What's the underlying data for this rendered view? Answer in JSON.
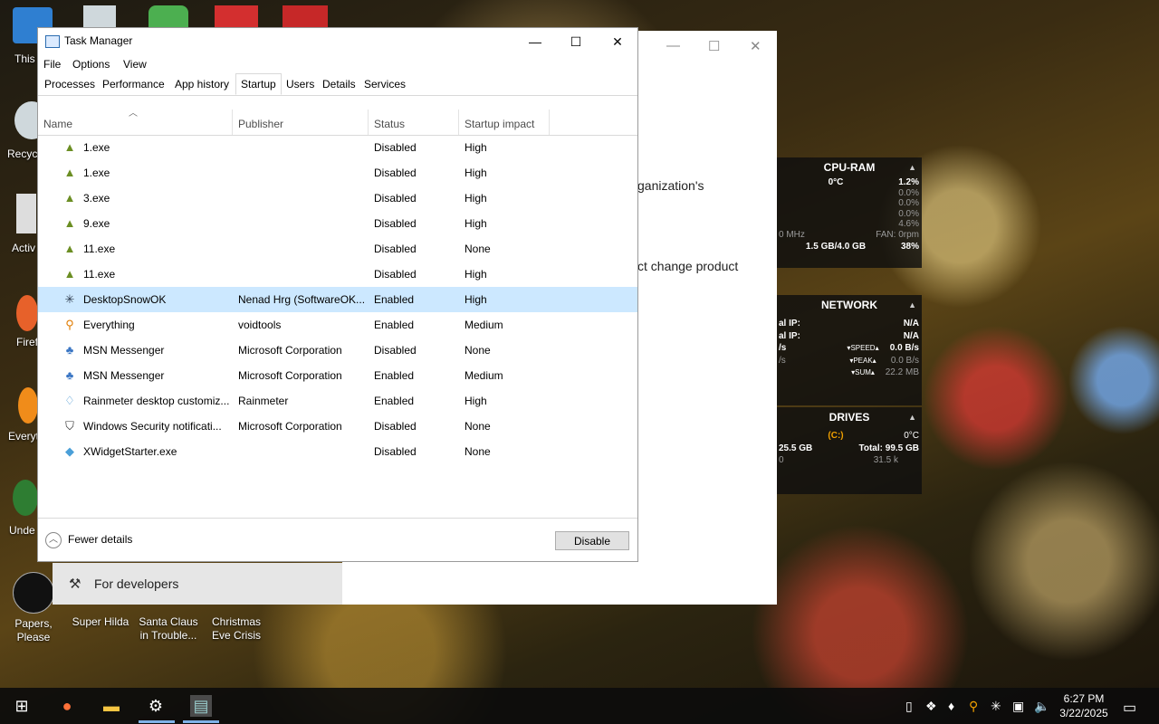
{
  "desktop": {
    "icons": [
      {
        "label": "Papers,\nPlease"
      },
      {
        "label": "Super Hilda"
      },
      {
        "label": "Santa Claus\nin Trouble..."
      },
      {
        "label": "Christmas\nEve Crisis"
      }
    ],
    "left_labels": [
      "This",
      "Recycl",
      "Activ",
      "Firef",
      "Everyt",
      "Unde"
    ]
  },
  "bg_window": {
    "text1": "ganization's",
    "text2": "ct change product",
    "side_label": "For developers"
  },
  "task_manager": {
    "title": "Task Manager",
    "menu": [
      "File",
      "Options",
      "View"
    ],
    "tabs": [
      "Processes",
      "Performance",
      "App history",
      "Startup",
      "Users",
      "Details",
      "Services"
    ],
    "active_tab": "Startup",
    "columns": [
      "Name",
      "Publisher",
      "Status",
      "Startup impact"
    ],
    "rows": [
      {
        "icon": "tree-icon",
        "name": "1.exe",
        "publisher": "",
        "status": "Disabled",
        "impact": "High"
      },
      {
        "icon": "tree-icon",
        "name": "1.exe",
        "publisher": "",
        "status": "Disabled",
        "impact": "High"
      },
      {
        "icon": "tree-icon",
        "name": "3.exe",
        "publisher": "",
        "status": "Disabled",
        "impact": "High"
      },
      {
        "icon": "tree-icon",
        "name": "9.exe",
        "publisher": "",
        "status": "Disabled",
        "impact": "High"
      },
      {
        "icon": "tree-icon",
        "name": "11.exe",
        "publisher": "",
        "status": "Disabled",
        "impact": "None"
      },
      {
        "icon": "tree-icon",
        "name": "11.exe",
        "publisher": "",
        "status": "Disabled",
        "impact": "High"
      },
      {
        "icon": "snowflake-icon",
        "name": "DesktopSnowOK",
        "publisher": "Nenad Hrg (SoftwareOK...",
        "status": "Enabled",
        "impact": "High",
        "selected": true
      },
      {
        "icon": "magnifier-icon",
        "name": "Everything",
        "publisher": "voidtools",
        "status": "Enabled",
        "impact": "Medium"
      },
      {
        "icon": "messenger-icon",
        "name": "MSN Messenger",
        "publisher": "Microsoft Corporation",
        "status": "Disabled",
        "impact": "None"
      },
      {
        "icon": "messenger-icon",
        "name": "MSN Messenger",
        "publisher": "Microsoft Corporation",
        "status": "Enabled",
        "impact": "Medium"
      },
      {
        "icon": "droplet-icon",
        "name": "Rainmeter desktop customiz...",
        "publisher": "Rainmeter",
        "status": "Enabled",
        "impact": "High"
      },
      {
        "icon": "shield-icon",
        "name": "Windows Security notificati...",
        "publisher": "Microsoft Corporation",
        "status": "Disabled",
        "impact": "None"
      },
      {
        "icon": "widget-icon",
        "name": "XWidgetStarter.exe",
        "publisher": "",
        "status": "Disabled",
        "impact": "None"
      }
    ],
    "fewer_details": "Fewer details",
    "disable_button": "Disable"
  },
  "cpu_ram": {
    "title": "CPU-RAM",
    "temp": "0°C",
    "total": "1.2%",
    "cores": [
      "0.0%",
      "0.0%",
      "0.0%",
      "4.6%"
    ],
    "mhz": "0 MHz",
    "fan": "FAN: 0rpm",
    "ram": "1.5 GB/4.0 GB",
    "ram_pct": "38%"
  },
  "network": {
    "title": "NETWORK",
    "ip1_label": "al IP:",
    "ip1": "N/A",
    "ip2_label": "al IP:",
    "ip2": "N/A",
    "speed_label": "SPEED",
    "speed": "0.0 B/s",
    "peak_label": "PEAK",
    "peak": "0.0 B/s",
    "sum_label": "SUM",
    "sum": "22.2 MB",
    "unit_left1": "/s",
    "unit_left2": "/s"
  },
  "drives": {
    "title": "DRIVES",
    "drive": "(C:)",
    "temp": "0°C",
    "used": "25.5 GB",
    "total": "Total: 99.5 GB",
    "left_val": "0",
    "rw": "31.5 k"
  },
  "taskbar": {
    "time": "6:27 PM",
    "date": "3/22/2025"
  },
  "colors": {
    "selection": "#cce8ff",
    "taskbar": "#0c0c0c",
    "accent": "#7fb2e8"
  }
}
